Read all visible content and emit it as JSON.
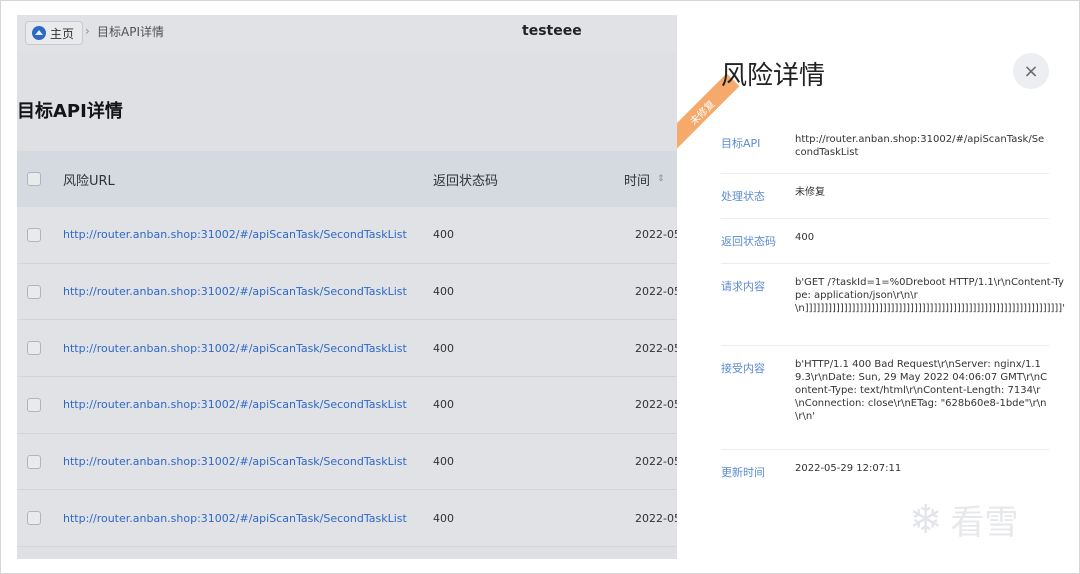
{
  "topbar": {
    "home_label": "主页",
    "breadcrumb_sep": "›",
    "breadcrumb_current": "目标API详情",
    "user": "testeee"
  },
  "page": {
    "title": "目标API详情"
  },
  "table": {
    "headers": {
      "url": "风险URL",
      "code": "返回状态码",
      "time": "时间",
      "sort": "⇕"
    },
    "rows": [
      {
        "url": "http://router.anban.shop:31002/#/apiScanTask/SecondTaskList",
        "code": "400",
        "time": "2022-05-"
      },
      {
        "url": "http://router.anban.shop:31002/#/apiScanTask/SecondTaskList",
        "code": "400",
        "time": "2022-05-"
      },
      {
        "url": "http://router.anban.shop:31002/#/apiScanTask/SecondTaskList",
        "code": "400",
        "time": "2022-05-"
      },
      {
        "url": "http://router.anban.shop:31002/#/apiScanTask/SecondTaskList",
        "code": "400",
        "time": "2022-05-"
      },
      {
        "url": "http://router.anban.shop:31002/#/apiScanTask/SecondTaskList",
        "code": "400",
        "time": "2022-05-"
      },
      {
        "url": "http://router.anban.shop:31002/#/apiScanTask/SecondTaskList",
        "code": "400",
        "time": "2022-05-"
      }
    ]
  },
  "drawer": {
    "title": "风险详情",
    "close_icon": "×",
    "ribbon": "未修复",
    "fields": [
      {
        "label": "目标API",
        "value": "http://router.anban.shop:31002/#/apiScanTask/SecondTaskList"
      },
      {
        "label": "处理状态",
        "value": "未修复"
      },
      {
        "label": "返回状态码",
        "value": "400"
      },
      {
        "label": "请求内容",
        "value": "b'GET /?taskId=1=%0Dreboot HTTP/1.1\\r\\nContent-Type: application/json\\r\\n\\r\\n]]]]]]]]]]]]]]]]]]]]]]]]]]]]]]]]]]]]]]]]]]]]]]]]]]]]]]]]]]]]]]]]]]'"
      },
      {
        "label": "接受内容",
        "value": "b'HTTP/1.1 400 Bad Request\\r\\nServer: nginx/1.19.3\\r\\nDate: Sun, 29 May 2022 04:06:07 GMT\\r\\nContent-Type: text/html\\r\\nContent-Length: 7134\\r\\nConnection: close\\r\\nETag: \"628b60e8-1bde\"\\r\\n\\r\\n'"
      },
      {
        "label": "更新时间",
        "value": "2022-05-29 12:07:11"
      }
    ]
  },
  "watermark": {
    "icon": "❄",
    "text": "看雪"
  },
  "colors": {
    "link": "#2f6fd6",
    "ribbon": "#f5a96a",
    "label": "#5a8bd1"
  }
}
